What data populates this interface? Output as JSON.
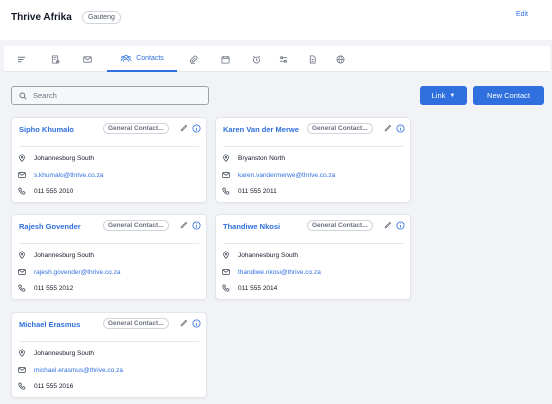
{
  "header": {
    "company_name": "Thrive Afrika",
    "region_badge": "Gauteng",
    "edit_label": "Edit"
  },
  "tabs": [
    {
      "icon": "list-icon",
      "label": ""
    },
    {
      "icon": "document-settings-icon",
      "label": ""
    },
    {
      "icon": "envelope-icon",
      "label": ""
    },
    {
      "icon": "contacts-icon",
      "label": "Contacts",
      "active": true
    },
    {
      "icon": "paperclip-icon",
      "label": ""
    },
    {
      "icon": "calendar-icon",
      "label": ""
    },
    {
      "icon": "alarm-clock-icon",
      "label": ""
    },
    {
      "icon": "sliders-icon",
      "label": ""
    },
    {
      "icon": "file-icon",
      "label": ""
    },
    {
      "icon": "globe-icon",
      "label": ""
    }
  ],
  "toolbar": {
    "search_placeholder": "Search",
    "link_button": "Link",
    "new_contact_button": "New Contact"
  },
  "contacts": [
    {
      "name": "Sipho Khumalo",
      "type": "General Contact...",
      "location": "Johannesburg South",
      "email": "s.khumalo@thrive.co.za",
      "phone": "011 555 2010"
    },
    {
      "name": "Karen Van der Merwe",
      "type": "General Contact...",
      "location": "Bryanston North",
      "email": "karen.vandermerwe@thrive.co.za",
      "phone": "011 555 2011"
    },
    {
      "name": "Rajesh Govender",
      "type": "General Contact...",
      "location": "Johannesburg South",
      "email": "rajesh.govender@thrive.co.za",
      "phone": "011 555 2012"
    },
    {
      "name": "Thandiwe Nkosi",
      "type": "General Contact...",
      "location": "Johannesburg South",
      "email": "thandiwe.nkosi@thrive.co.za",
      "phone": "011 555 2014"
    },
    {
      "name": "Michael Erasmus",
      "type": "General Contact...",
      "location": "Johannesburg South",
      "email": "michael.erasmus@thrive.co.za",
      "phone": "011 555 2016"
    }
  ],
  "colors": {
    "accent": "#2f6fde",
    "background": "#f1f3f6",
    "card": "#ffffff"
  }
}
